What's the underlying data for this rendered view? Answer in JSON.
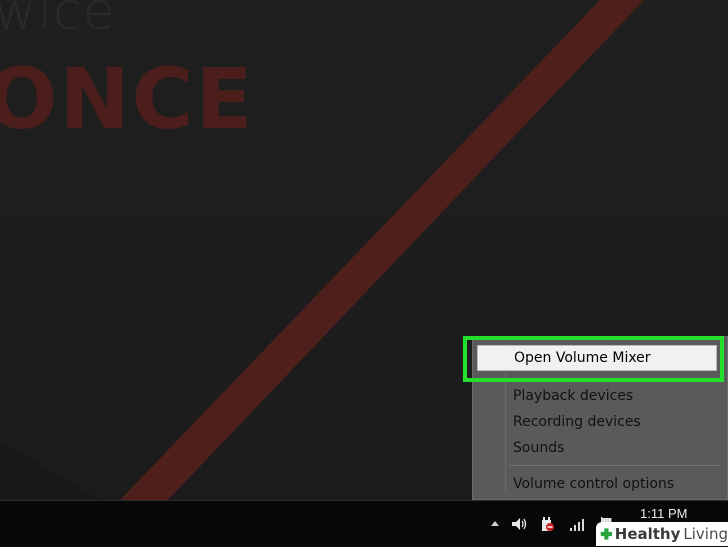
{
  "wallpaper": {
    "partial_word_top": "wice",
    "partial_word_main": "ONCE"
  },
  "context_menu": {
    "items": [
      {
        "label": "Open Volume Mixer",
        "highlighted": true
      },
      {
        "label": "Playback devices"
      },
      {
        "label": "Recording devices"
      },
      {
        "label": "Sounds"
      },
      {
        "label": "Volume control options"
      }
    ]
  },
  "taskbar": {
    "clock": "1:11 PM",
    "tray_icons": [
      "show-hidden-icons-arrow",
      "speaker-icon",
      "power-plug-icon",
      "signal-bars-icon",
      "flag-icon"
    ]
  },
  "watermark": {
    "brand_bold": "Healthy",
    "brand_regular": "Living"
  },
  "colors": {
    "highlight_border": "#23e02a",
    "wallpaper_stripe": "#5a221f",
    "menu_background": "#5a5a5a"
  }
}
